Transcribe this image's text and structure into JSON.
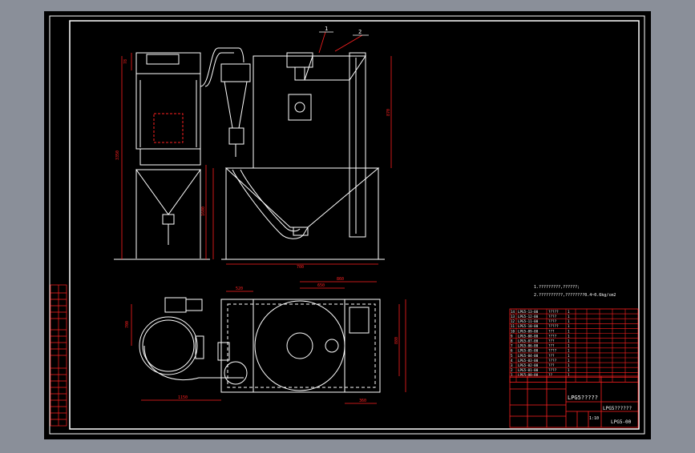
{
  "colors": {
    "background": "#8a8f99",
    "sheet": "#000000",
    "frame": "#ffffff",
    "part": "#ffffff",
    "dimension": "#ff2020",
    "hidden": "#ff2020"
  },
  "balloons": {
    "one": "1",
    "two": "2"
  },
  "dims": {
    "top_left_v": "78",
    "width_right": "980",
    "base_width": "700",
    "height_left": "3350",
    "height_mid": "1600",
    "height_right": "870",
    "plan_a": "700",
    "plan_b": "520",
    "plan_c": "860",
    "plan_d": "650",
    "plan_e": "1150",
    "plan_f": "1600",
    "plan_g": "880",
    "plan_h": "360"
  },
  "notes": {
    "line1": "1.?????????,??????;",
    "line2": "2.??????????,????????0.4~0.6kg/cm2"
  },
  "bom_rows": [
    {
      "no": "14",
      "code": "LPG5-13-00",
      "name": "?????",
      "qty": "1"
    },
    {
      "no": "13",
      "code": "LPG5-12-00",
      "name": "????",
      "qty": "1"
    },
    {
      "no": "12",
      "code": "LPG5-11-00",
      "name": "????",
      "qty": "1"
    },
    {
      "no": "11",
      "code": "LPG5-10-00",
      "name": "?????",
      "qty": "1"
    },
    {
      "no": "10",
      "code": "LPG5-09-00",
      "name": "???",
      "qty": "1"
    },
    {
      "no": "9",
      "code": "LPG5-08-00",
      "name": "????",
      "qty": "1"
    },
    {
      "no": "8",
      "code": "LPG5-07-00",
      "name": "???",
      "qty": "1"
    },
    {
      "no": "7",
      "code": "LPG5-06-00",
      "name": "???",
      "qty": "1"
    },
    {
      "no": "6",
      "code": "LPG5-05-00",
      "name": "????",
      "qty": "1"
    },
    {
      "no": "5",
      "code": "LPG5-04-00",
      "name": "???",
      "qty": "1"
    },
    {
      "no": "4",
      "code": "LPG5-03-00",
      "name": "????",
      "qty": "1"
    },
    {
      "no": "3",
      "code": "LPG5-02-00",
      "name": "???",
      "qty": "1"
    },
    {
      "no": "2",
      "code": "LPG5-01-00",
      "name": "????",
      "qty": "1"
    },
    {
      "no": "1",
      "code": "LPG5-00-00",
      "name": "??",
      "qty": "1"
    }
  ],
  "title_block": {
    "title": "LPG5?????",
    "subtitle": "LPG5??????",
    "drawing_no": "LPG5-00",
    "scale": "1:10"
  }
}
